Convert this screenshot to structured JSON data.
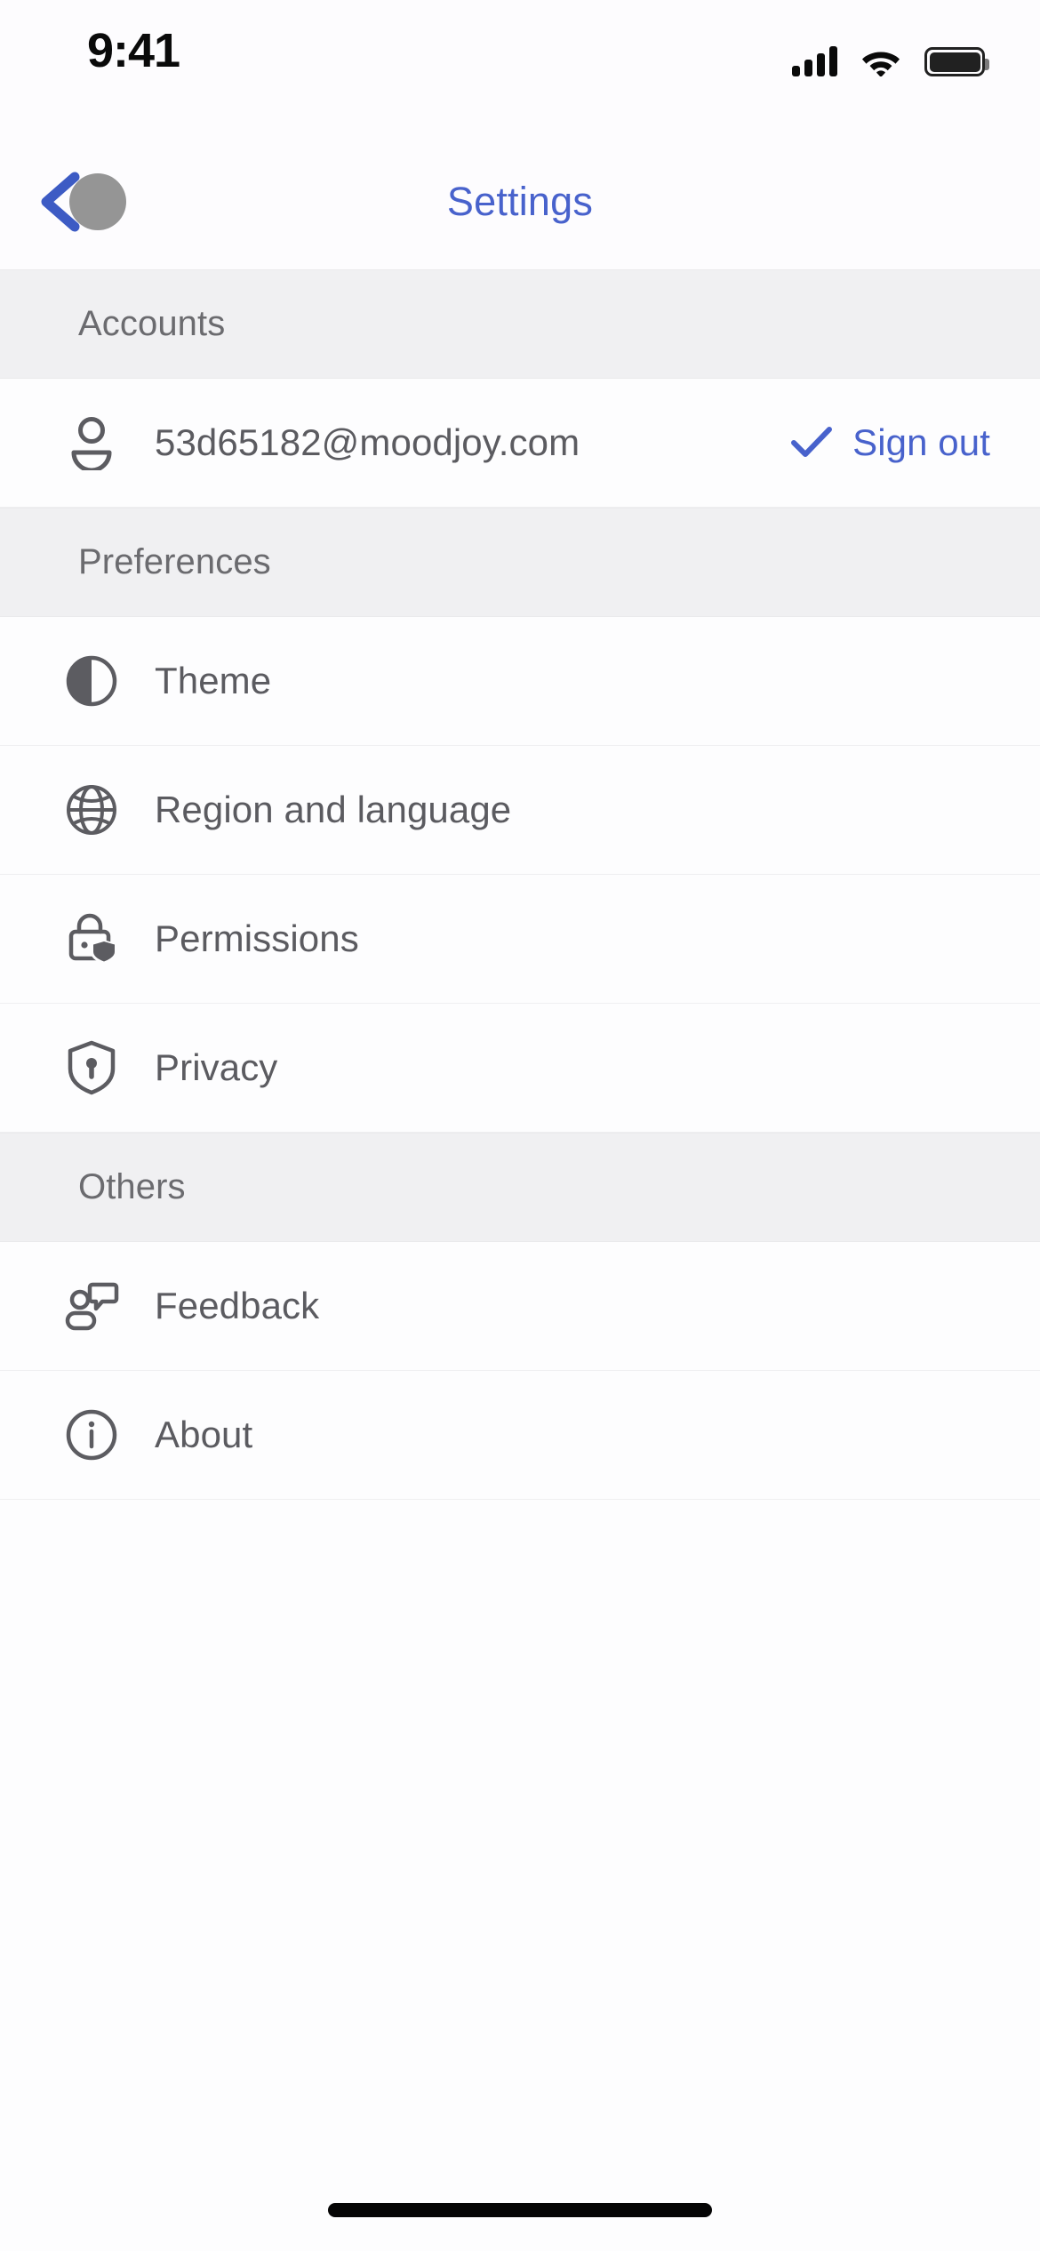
{
  "status_bar": {
    "time": "9:41",
    "cellular_icon": "cellular-signal-icon",
    "wifi_icon": "wifi-icon",
    "battery_icon": "battery-full-icon"
  },
  "nav": {
    "title": "Settings",
    "back_icon": "chevron-left-icon",
    "tap_indicator": "tap-indicator"
  },
  "colors": {
    "accent_blue": "#4862CC",
    "section_bg": "#F0F0F2",
    "row_bg": "#FDFDFE",
    "label_gray": "#5B5B60",
    "header_gray": "#6B6B6F",
    "divider": "#EFEFF1"
  },
  "sections": [
    {
      "title": "Accounts",
      "rows": [
        {
          "label": "53d65182@moodjoy.com",
          "icon": "user-icon",
          "action_label": "Sign out",
          "action_icon": "checkmark-icon"
        }
      ]
    },
    {
      "title": "Preferences",
      "rows": [
        {
          "label": "Theme",
          "icon": "contrast-half-circle-icon"
        },
        {
          "label": "Region and language",
          "icon": "globe-icon"
        },
        {
          "label": "Permissions",
          "icon": "lock-shield-icon"
        },
        {
          "label": "Privacy",
          "icon": "shield-keyhole-icon"
        }
      ]
    },
    {
      "title": "Others",
      "rows": [
        {
          "label": "Feedback",
          "icon": "person-speech-bubble-icon"
        },
        {
          "label": "About",
          "icon": "info-circle-icon"
        }
      ]
    }
  ],
  "home_indicator": "home-indicator"
}
